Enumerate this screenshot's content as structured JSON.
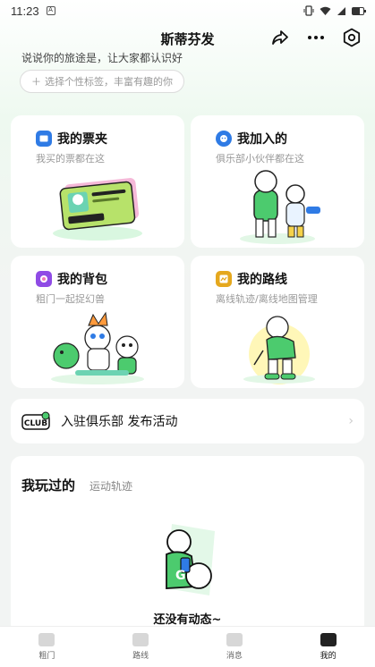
{
  "status_bar": {
    "time": "11:23"
  },
  "nav": {
    "title": "斯蒂芬发",
    "share_icon": "share-icon",
    "more_icon": "more-icon",
    "settings_icon": "settings-icon"
  },
  "profile": {
    "intro_text": "说说你的旅途是，让大家都认识好",
    "tag_button": "选择个性标签，丰富有趣的你"
  },
  "cards": [
    {
      "title": "我的票夹",
      "subtitle": "我买的票都在这",
      "icon": "ticket-folder-icon",
      "color": "#2f7be5"
    },
    {
      "title": "我加入的",
      "subtitle": "俱乐部小伙伴都在这",
      "icon": "club-joined-icon",
      "color": "#2f7be5"
    },
    {
      "title": "我的背包",
      "subtitle": "粗门一起捉幻兽",
      "icon": "backpack-icon",
      "color": "#8f4be5"
    },
    {
      "title": "我的路线",
      "subtitle": "离线轨迹/离线地图管理",
      "icon": "route-icon",
      "color": "#e5a81e"
    }
  ],
  "club_bar": {
    "logo_text": "CLUB",
    "label": "入驻俱乐部 发布活动"
  },
  "played": {
    "tab_active": "我玩过的",
    "tab_inactive": "运动轨迹",
    "empty_text": "还没有动态~"
  },
  "bottom_nav": [
    {
      "label": "粗门",
      "active": false
    },
    {
      "label": "路线",
      "active": false
    },
    {
      "label": "消息",
      "active": false
    },
    {
      "label": "我的",
      "active": true
    }
  ],
  "colors": {
    "accent_green": "#4ccb6e",
    "dark": "#111111"
  }
}
